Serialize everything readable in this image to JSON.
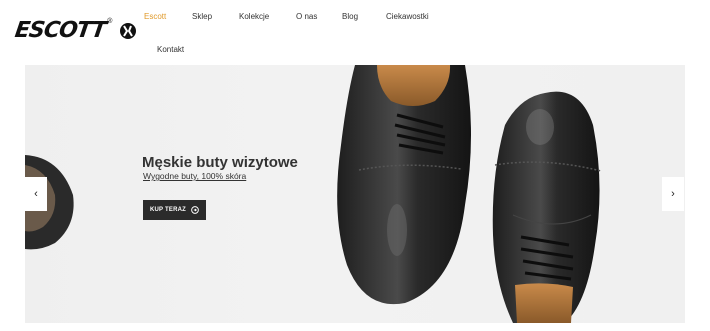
{
  "brand": {
    "logo_text": "ESCOTT",
    "logo_reg": "®"
  },
  "nav": {
    "items": [
      {
        "label": "Escott",
        "active": true
      },
      {
        "label": "Sklep",
        "active": false
      },
      {
        "label": "Kolekcje",
        "active": false
      },
      {
        "label": "O nas",
        "active": false
      },
      {
        "label": "Blog",
        "active": false
      },
      {
        "label": "Ciekawostki",
        "active": false
      },
      {
        "label": "Kontakt",
        "active": false
      }
    ]
  },
  "hero": {
    "title": "Męskie buty wizytowe",
    "subtitle": "Wygodne buty, 100% skóra",
    "button_label": "KUP TERAZ",
    "button_icon": "arrow-circle-right-icon",
    "prev_icon": "chevron-left-icon",
    "next_icon": "chevron-right-icon",
    "prev_glyph": "‹",
    "next_glyph": "›"
  },
  "colors": {
    "accent": "#e09a2a",
    "button_bg": "#2b2b2b",
    "hero_bg": "#f0f0f0"
  }
}
